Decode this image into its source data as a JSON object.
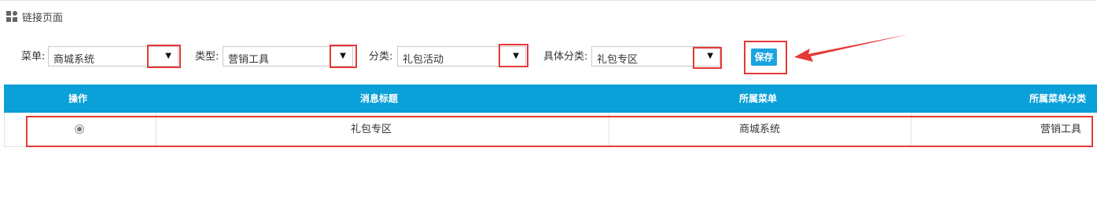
{
  "page": {
    "title": "链接页面",
    "icon": "grid-icon"
  },
  "filters": {
    "menu": {
      "label": "菜单:",
      "value": "商城系统"
    },
    "type": {
      "label": "类型:",
      "value": "营销工具"
    },
    "category": {
      "label": "分类:",
      "value": "礼包活动"
    },
    "subcategory": {
      "label": "具体分类:",
      "value": "礼包专区"
    },
    "dropdown_arrow": "▼"
  },
  "save_button": {
    "label": "保存"
  },
  "annotation": {
    "color": "#e53935"
  },
  "table": {
    "header_color": "#0aa0d8",
    "columns": [
      "操作",
      "消息标题",
      "所属菜单",
      "所属菜单分类"
    ],
    "rows": [
      {
        "selected": true,
        "title": "礼包专区",
        "menu": "商城系统",
        "menu_category": "营销工具"
      }
    ]
  }
}
